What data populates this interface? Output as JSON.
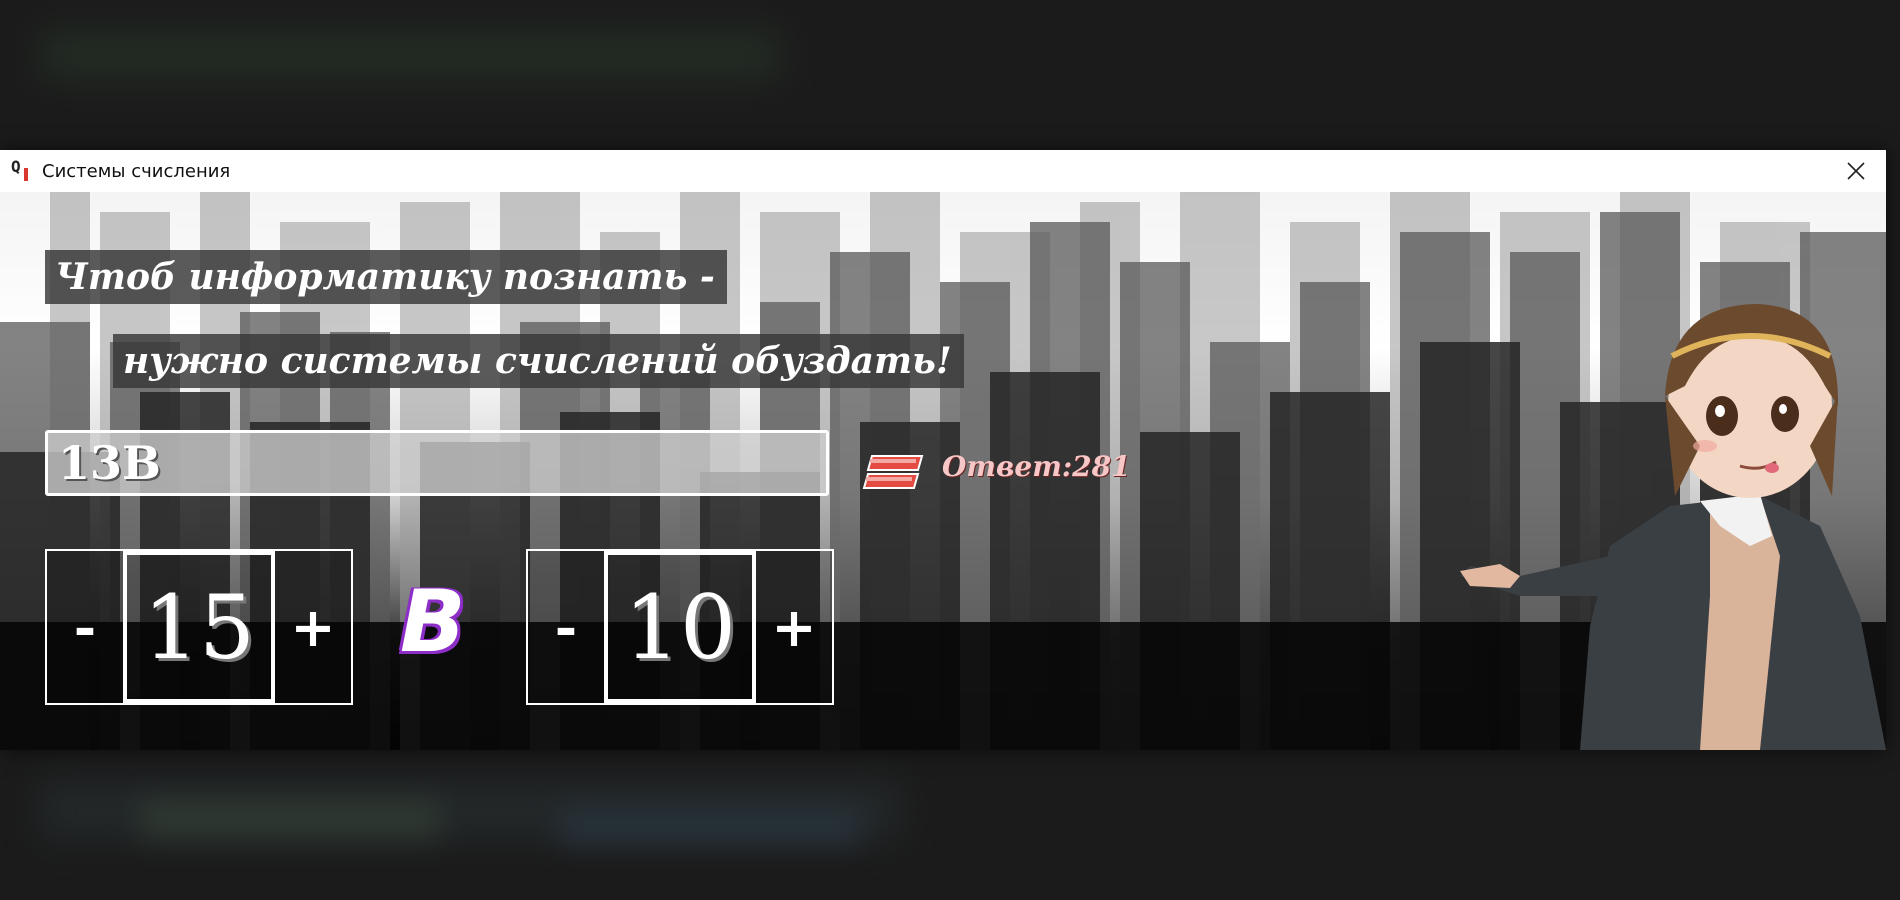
{
  "window": {
    "title": "Системы счисления",
    "icon": "app-icon"
  },
  "slogan": {
    "line1": "Чтоб информатику познать -",
    "line2": "нужно системы счислений обуздать!"
  },
  "input": {
    "value": "13B"
  },
  "answer": {
    "text": "Ответ:281",
    "color": "#f7c6c6"
  },
  "from_base": {
    "minus": "-",
    "value": "15",
    "plus": "+"
  },
  "separator": "В",
  "to_base": {
    "minus": "-",
    "value": "10",
    "plus": "+"
  },
  "colors": {
    "accent_purple": "#8d2ec8",
    "convert_button": "#e34b43"
  }
}
